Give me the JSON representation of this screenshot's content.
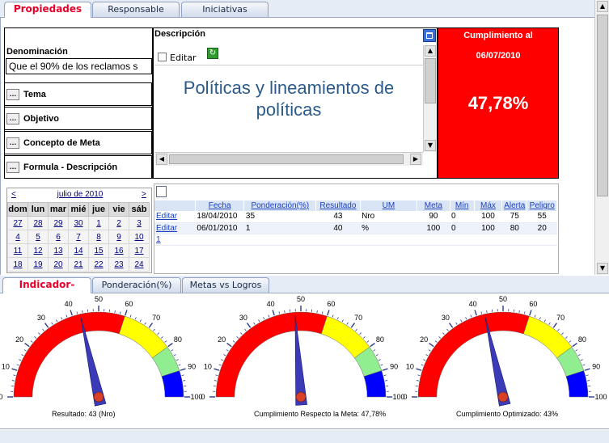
{
  "top_tabs": [
    {
      "label": "Propiedades",
      "active": true
    },
    {
      "label": "Responsable",
      "active": false
    },
    {
      "label": "Iniciativas",
      "active": false
    }
  ],
  "properties": {
    "denominacion_label": "Denominación",
    "denominacion_value": "Que el 90% de los reclamos s",
    "buttons": [
      "Tema",
      "Objetivo",
      "Concepto de Meta",
      "Formula - Descripción"
    ]
  },
  "description": {
    "label": "Descripción",
    "edit_label": "Editar",
    "text": "Políticas y lineamientos de políticas"
  },
  "compliance": {
    "title": "Cumplimiento al",
    "date": "06/07/2010",
    "value": "47,78%",
    "color": "#ff0000"
  },
  "calendar": {
    "prev": "<",
    "next": ">",
    "month": "julio de 2010",
    "weekdays": [
      "dom",
      "lun",
      "mar",
      "mié",
      "jue",
      "vie",
      "sáb"
    ],
    "weeks": [
      [
        "27",
        "28",
        "29",
        "30",
        "1",
        "2",
        "3"
      ],
      [
        "4",
        "5",
        "6",
        "7",
        "8",
        "9",
        "10"
      ],
      [
        "11",
        "12",
        "13",
        "14",
        "15",
        "16",
        "17"
      ],
      [
        "18",
        "19",
        "20",
        "21",
        "22",
        "23",
        "24"
      ]
    ]
  },
  "grid": {
    "columns": [
      "Fecha",
      "Ponderación(%)",
      "Resultado",
      "UM",
      "Meta",
      "Mín",
      "Máx",
      "Alerta",
      "Peligro"
    ],
    "rows": [
      {
        "action": "Editar",
        "cells": [
          "18/04/2010",
          "35",
          "43",
          "Nro",
          "90",
          "0",
          "100",
          "75",
          "55"
        ]
      },
      {
        "action": "Editar",
        "cells": [
          "06/01/2010",
          "1",
          "40",
          "%",
          "100",
          "0",
          "100",
          "80",
          "20"
        ]
      }
    ],
    "pager": "1"
  },
  "bottom_tabs": [
    {
      "label": "Indicador-Gauge",
      "active": true
    },
    {
      "label": "Ponderación(%)",
      "active": false
    },
    {
      "label": "Metas vs Logros",
      "active": false
    }
  ],
  "gauges": [
    {
      "caption": "Resultado: 43 (Nro)",
      "value": 43
    },
    {
      "caption": "Cumplimiento Respecto la Meta: 47,78%",
      "value": 47.78
    },
    {
      "caption": "Cumplimiento Optimizado: 43%",
      "value": 43
    }
  ],
  "gauge_scale": {
    "ticks": [
      "0",
      "10",
      "20",
      "30",
      "40",
      "50",
      "60",
      "70",
      "80",
      "90",
      "100"
    ],
    "bands": [
      {
        "from": 0,
        "to": 60,
        "color": "#ff0000"
      },
      {
        "from": 60,
        "to": 80,
        "color": "#ffff00"
      },
      {
        "from": 80,
        "to": 90,
        "color": "#90ee90"
      },
      {
        "from": 90,
        "to": 100,
        "color": "#0000ff"
      }
    ]
  }
}
